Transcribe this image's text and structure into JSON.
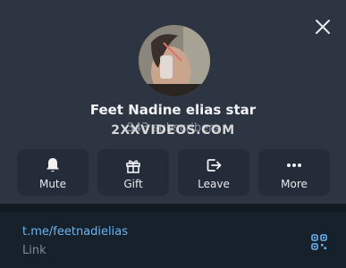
{
  "profile": {
    "name": "Feet Nadine elias star",
    "subscribers": "343 subscribers",
    "watermark": "2XXVIDEOS.COM"
  },
  "actions": [
    {
      "label": "Mute",
      "icon": "bell-icon"
    },
    {
      "label": "Gift",
      "icon": "gift-icon"
    },
    {
      "label": "Leave",
      "icon": "leave-icon"
    },
    {
      "label": "More",
      "icon": "more-icon"
    }
  ],
  "link": {
    "url": "t.me/feetnadielias",
    "caption": "Link"
  },
  "colors": {
    "accent": "#6ab3f3",
    "panel": "#2d3542",
    "button": "#232c38"
  }
}
